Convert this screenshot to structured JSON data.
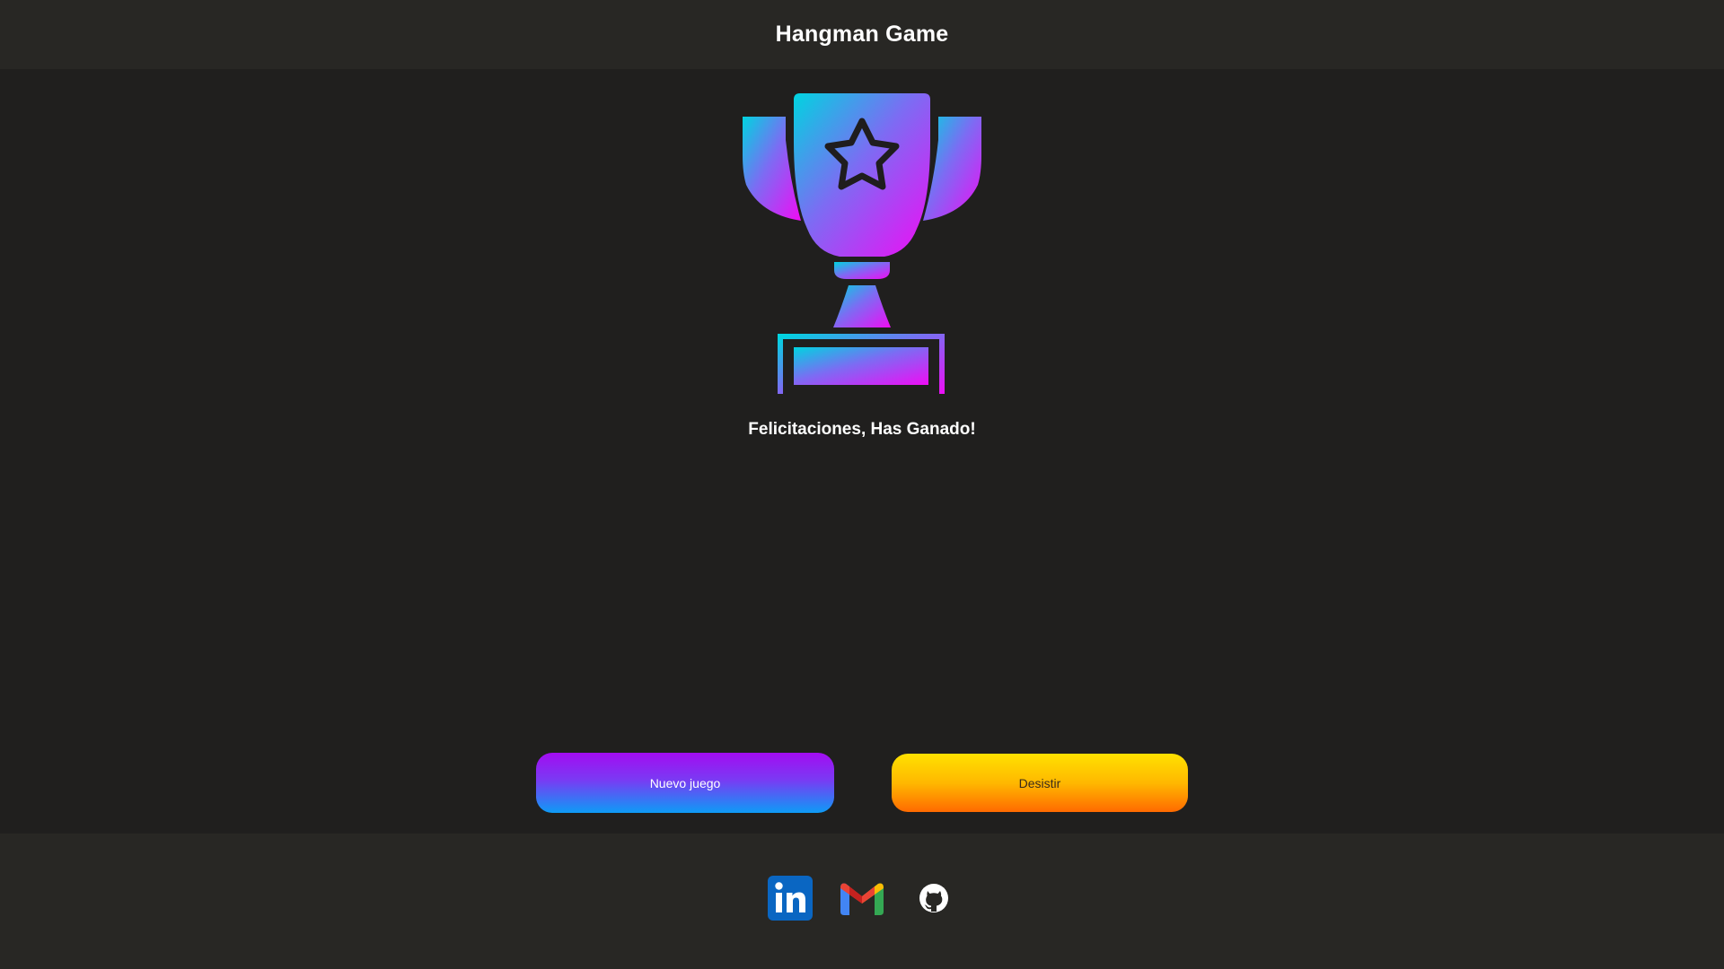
{
  "header": {
    "title": "Hangman Game"
  },
  "main": {
    "trophy_icon": "trophy-star-icon",
    "message": "Felicitaciones, Has Ganado!"
  },
  "actions": {
    "new_game_label": "Nuevo juego",
    "quit_label": "Desistir"
  },
  "footer": {
    "links": [
      {
        "icon": "linkedin-icon",
        "color": "#0a66c2"
      },
      {
        "icon": "gmail-icon",
        "color": "#ea4335"
      },
      {
        "icon": "github-icon",
        "color": "#ffffff"
      }
    ]
  },
  "colors": {
    "header_bg": "#282724",
    "page_bg": "#201f1e",
    "trophy_gradient_start": "#00d4e0",
    "trophy_gradient_mid": "#8c5cf3",
    "trophy_gradient_end": "#e80cf5",
    "new_game_gradient_top": "#a30cf2",
    "new_game_gradient_bottom": "#0d9cf6",
    "quit_gradient_top": "#ffe100",
    "quit_gradient_bottom": "#ff6a00"
  }
}
